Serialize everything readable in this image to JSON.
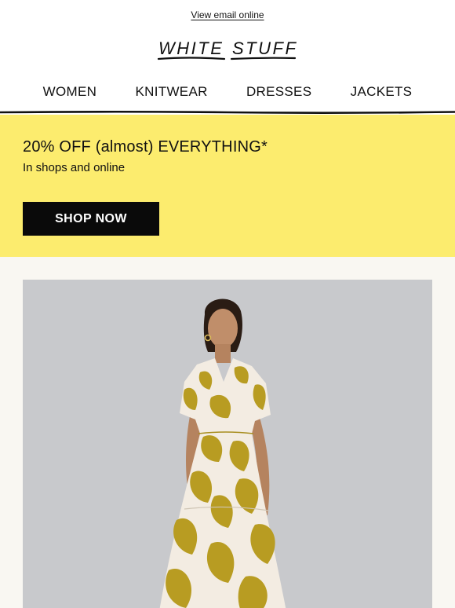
{
  "header": {
    "view_online_label": "View email online",
    "brand_name": "WHITE STUFF",
    "brand_logo_text_left": "WHITE",
    "brand_logo_text_right": "STUFF"
  },
  "nav": {
    "items": [
      {
        "label": "WOMEN"
      },
      {
        "label": "KNITWEAR"
      },
      {
        "label": "DRESSES"
      },
      {
        "label": "JACKETS"
      }
    ]
  },
  "promo": {
    "title": "20% OFF (almost) EVERYTHING*",
    "subtitle": "In shops and online",
    "cta_label": "SHOP NOW",
    "background_color": "#fcec6e"
  },
  "hero": {
    "image_alt": "Woman wearing mustard and white leaf print tiered maxi dress",
    "dress_color": "#b89c22",
    "background_color": "#c6c7ca"
  },
  "colors": {
    "text": "#111111",
    "button_bg": "#0a0a0a",
    "button_text": "#ffffff",
    "section_bg": "#f9f7f2"
  }
}
